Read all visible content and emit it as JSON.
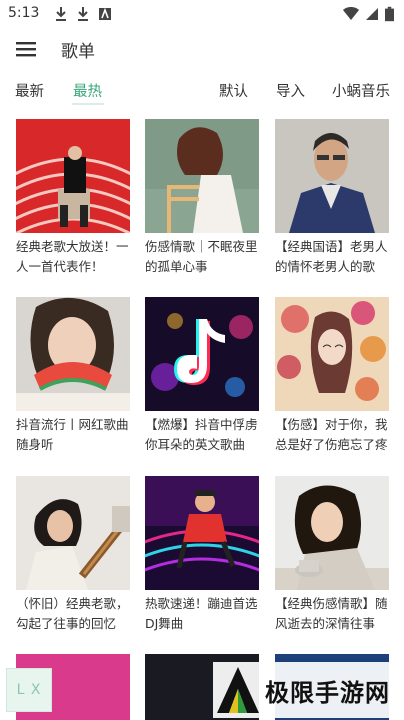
{
  "status_bar": {
    "time": "5:13"
  },
  "app_bar": {
    "title": "歌单"
  },
  "tabs": {
    "latest": "最新",
    "hot": "最热",
    "active": "最热"
  },
  "actions": {
    "default": "默认",
    "import": "导入",
    "source": "小蜗音乐"
  },
  "playlists": [
    {
      "title": "经典老歌大放送！一人一首代表作！"
    },
    {
      "title": "伤感情歌｜不眠夜里的孤单心事"
    },
    {
      "title": "【经典国语】老男人的情怀老男人的歌"
    },
    {
      "title": "抖音流行丨网红歌曲随身听"
    },
    {
      "title": "【燃爆】抖音中俘虏你耳朵的英文歌曲"
    },
    {
      "title": "【伤感】对于你，我总是好了伤疤忘了疼"
    },
    {
      "title": "（怀旧）经典老歌，勾起了往事的回忆"
    },
    {
      "title": "热歌速递！蹦迪首选DJ舞曲"
    },
    {
      "title": "【经典伤感情歌】随风逝去的深情往事"
    }
  ],
  "bottom": {
    "lx_label": "L X"
  },
  "watermark": {
    "text": "极限手游网"
  },
  "colors": {
    "accent": "#3aa57a",
    "text": "#333333"
  }
}
